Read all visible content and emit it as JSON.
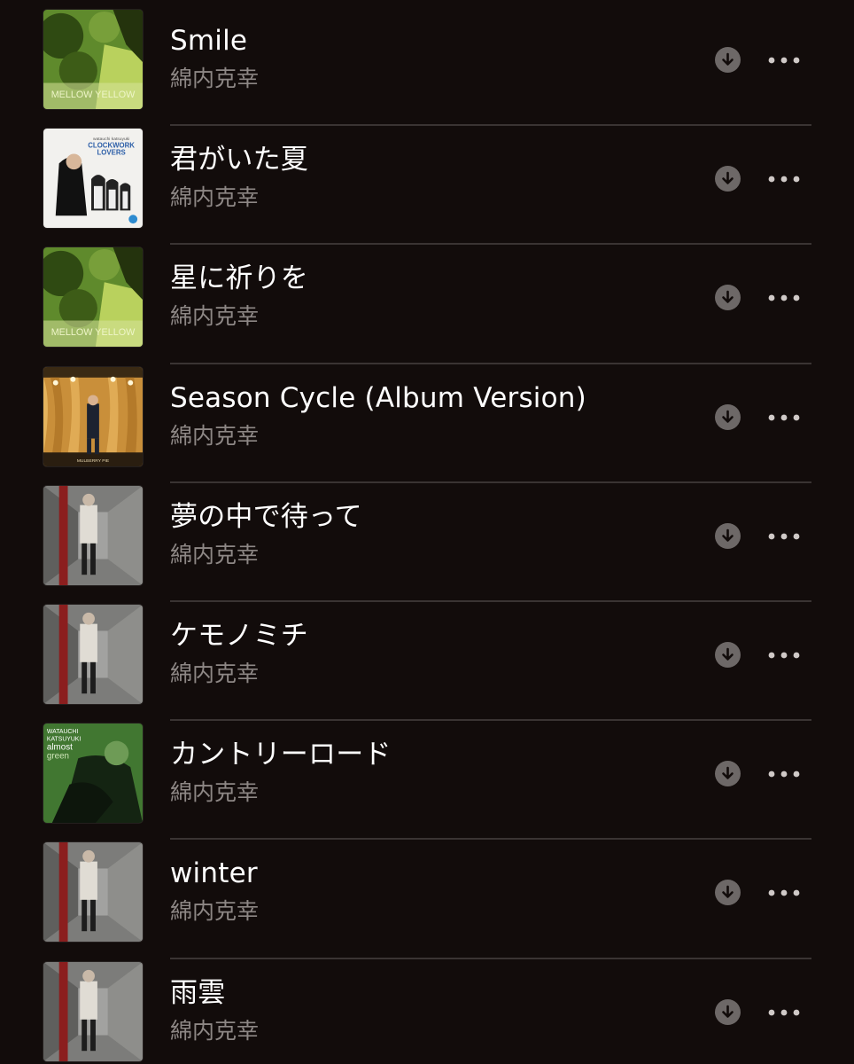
{
  "songs": [
    {
      "title": "Smile",
      "artist": "綿内克幸",
      "art": "mellow-yellow-cover"
    },
    {
      "title": "君がいた夏",
      "artist": "綿内克幸",
      "art": "clockwork-lovers-cover"
    },
    {
      "title": "星に祈りを",
      "artist": "綿内克幸",
      "art": "mellow-yellow-cover"
    },
    {
      "title": "Season Cycle (Album Version)",
      "artist": "綿内克幸",
      "art": "stage-curtain-cover"
    },
    {
      "title": "夢の中で待って",
      "artist": "綿内克幸",
      "art": "corridor-red-cover"
    },
    {
      "title": "ケモノミチ",
      "artist": "綿内克幸",
      "art": "corridor-red-cover"
    },
    {
      "title": "カントリーロード",
      "artist": "綿内克幸",
      "art": "almost-green-cover"
    },
    {
      "title": "winter",
      "artist": "綿内克幸",
      "art": "corridor-red-cover"
    },
    {
      "title": "雨雲",
      "artist": "綿内克幸",
      "art": "corridor-red-cover"
    }
  ],
  "covers": {
    "mellow-yellow-cover": {
      "text": "MELLOW YELLOW"
    },
    "clockwork-lovers-cover": {
      "text": "CLOCKWORK LOVERS",
      "small": "watauchi katsuyuki"
    },
    "stage-curtain-cover": {
      "text": "MULBERRY PIE"
    },
    "almost-green-cover": {
      "text_top": "WATAUCHI KATSUYUKI",
      "text_main": "almost green"
    }
  },
  "icons": {
    "download": "arrow-down-circle-icon",
    "more": "ellipsis-icon"
  },
  "colors": {
    "background": "#120c0b",
    "title": "#ffffff",
    "artist": "#8d8785",
    "icon_bg": "#6d6867",
    "divider": "#3a3433"
  }
}
